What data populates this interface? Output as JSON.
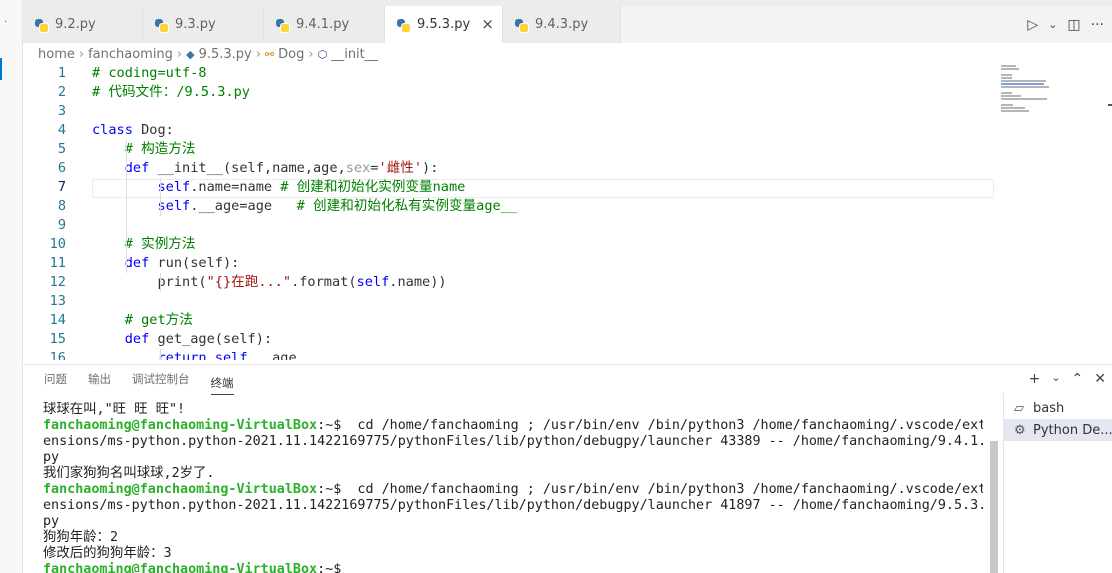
{
  "tabs": [
    {
      "label": "9.2.py",
      "active": false
    },
    {
      "label": "9.3.py",
      "active": false
    },
    {
      "label": "9.4.1.py",
      "active": false
    },
    {
      "label": "9.5.3.py",
      "active": true
    },
    {
      "label": "9.4.3.py",
      "active": false
    }
  ],
  "tab_close": "×",
  "toolbar": {
    "run_icon": "▷",
    "run_dropdown": "⌄",
    "split_icon": "◫",
    "more_icon": "···"
  },
  "breadcrumb": {
    "items": [
      "home",
      "fanchaoming",
      "9.5.3.py",
      "Dog",
      "__init__"
    ],
    "separator": "›"
  },
  "editor": {
    "current_line": 7,
    "lines": [
      {
        "n": "1",
        "tokens": [
          {
            "t": "# coding=utf-8",
            "c": "c"
          }
        ]
      },
      {
        "n": "2",
        "tokens": [
          {
            "t": "# 代码文件：/9.5.3.py",
            "c": "c"
          }
        ]
      },
      {
        "n": "3",
        "tokens": []
      },
      {
        "n": "4",
        "tokens": [
          {
            "t": "class",
            "c": "k"
          },
          {
            "t": " Dog:",
            "c": "d"
          }
        ]
      },
      {
        "n": "5",
        "tokens": [
          {
            "t": "    # 构造方法",
            "c": "c"
          }
        ]
      },
      {
        "n": "6",
        "tokens": [
          {
            "t": "    ",
            "c": "d"
          },
          {
            "t": "def",
            "c": "k"
          },
          {
            "t": " __init__(self,name,age,",
            "c": "d"
          },
          {
            "t": "sex",
            "c": "p"
          },
          {
            "t": "=",
            "c": "d"
          },
          {
            "t": "'雌性'",
            "c": "s"
          },
          {
            "t": "):",
            "c": "d"
          }
        ]
      },
      {
        "n": "7",
        "tokens": [
          {
            "t": "        ",
            "c": "d"
          },
          {
            "t": "self",
            "c": "self"
          },
          {
            "t": ".name=name ",
            "c": "d"
          },
          {
            "t": "# 创建和初始化实例变量name",
            "c": "c"
          }
        ]
      },
      {
        "n": "8",
        "tokens": [
          {
            "t": "        ",
            "c": "d"
          },
          {
            "t": "self",
            "c": "self"
          },
          {
            "t": ".__age=age   ",
            "c": "d"
          },
          {
            "t": "# 创建和初始化私有实例变量age__",
            "c": "c"
          }
        ]
      },
      {
        "n": "9",
        "tokens": []
      },
      {
        "n": "10",
        "tokens": [
          {
            "t": "    # 实例方法",
            "c": "c"
          }
        ]
      },
      {
        "n": "11",
        "tokens": [
          {
            "t": "    ",
            "c": "d"
          },
          {
            "t": "def",
            "c": "k"
          },
          {
            "t": " run(self):",
            "c": "d"
          }
        ]
      },
      {
        "n": "12",
        "tokens": [
          {
            "t": "        print(",
            "c": "d"
          },
          {
            "t": "\"{}在跑...\"",
            "c": "s"
          },
          {
            "t": ".format(",
            "c": "d"
          },
          {
            "t": "self",
            "c": "self"
          },
          {
            "t": ".name))",
            "c": "d"
          }
        ]
      },
      {
        "n": "13",
        "tokens": []
      },
      {
        "n": "14",
        "tokens": [
          {
            "t": "    # get方法",
            "c": "c"
          }
        ]
      },
      {
        "n": "15",
        "tokens": [
          {
            "t": "    ",
            "c": "d"
          },
          {
            "t": "def",
            "c": "k"
          },
          {
            "t": " get_age(self):",
            "c": "d"
          }
        ]
      },
      {
        "n": "16",
        "tokens": [
          {
            "t": "        ",
            "c": "d"
          },
          {
            "t": "return",
            "c": "k"
          },
          {
            "t": " ",
            "c": "d"
          },
          {
            "t": "self",
            "c": "self"
          },
          {
            "t": ".__age",
            "c": "d"
          }
        ]
      }
    ]
  },
  "panel": {
    "tabs": [
      {
        "label": "问题",
        "active": false
      },
      {
        "label": "输出",
        "active": false
      },
      {
        "label": "调试控制台",
        "active": false
      },
      {
        "label": "终端",
        "active": true
      }
    ],
    "tools": [
      "+",
      "⌄",
      "⌃",
      "✕"
    ],
    "terminal_lines": [
      {
        "text": "球球在叫,\"旺 旺 旺\"!"
      },
      {
        "prompt": "fanchaoming@fanchaoming-VirtualBox",
        "path": ":~$",
        "text": "  cd /home/fanchaoming ; /usr/bin/env /bin/python3 /home/fanchaoming/.vscode/ext"
      },
      {
        "text": "ensions/ms-python.python-2021.11.1422169775/pythonFiles/lib/python/debugpy/launcher 43389 -- /home/fanchaoming/9.4.1."
      },
      {
        "text": "py"
      },
      {
        "text": "我们家狗狗名叫球球,2岁了."
      },
      {
        "prompt": "fanchaoming@fanchaoming-VirtualBox",
        "path": ":~$",
        "text": "  cd /home/fanchaoming ; /usr/bin/env /bin/python3 /home/fanchaoming/.vscode/ext"
      },
      {
        "text": "ensions/ms-python.python-2021.11.1422169775/pythonFiles/lib/python/debugpy/launcher 41897 -- /home/fanchaoming/9.5.3."
      },
      {
        "text": "py"
      },
      {
        "text": "狗狗年龄：2"
      },
      {
        "text": "修改后的狗狗年龄：3"
      },
      {
        "prompt": "fanchaoming@fanchaoming-VirtualBox",
        "path": ":~$",
        "text": ""
      }
    ],
    "terminal_instances": [
      {
        "label": "bash",
        "icon": "terminal-icon",
        "selected": false
      },
      {
        "label": "Python De...",
        "icon": "gear-icon",
        "selected": true
      }
    ]
  }
}
